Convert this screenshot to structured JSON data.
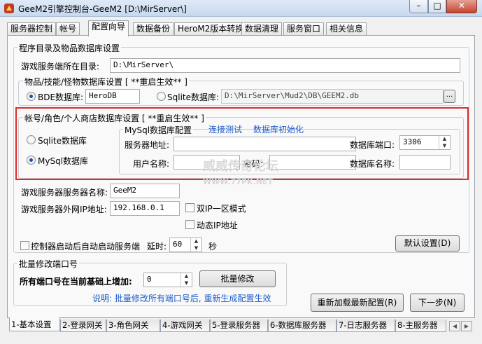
{
  "window": {
    "title": "GeeM2引擎控制台-GeeM2 [D:\\MirServer\\]"
  },
  "top_tabs": [
    "服务器控制",
    "帐号",
    "配置向导",
    "数据备份",
    "HeroM2版本转换",
    "数据清理",
    "服务窗口",
    "相关信息"
  ],
  "program_group": {
    "title": "程序目录及物品数据库设置",
    "server_dir_label": "游戏服务端所在目录:",
    "server_dir_value": "D:\\MirServer\\",
    "items_group": {
      "title": "物品/技能/怪物数据库设置 [ **重启生效** ]",
      "bde_label": "BDE数据库:",
      "bde_value": "HeroDB",
      "sqlite_label": "Sqlite数据库:",
      "sqlite_value": "D:\\MirServer\\Mud2\\DB\\GEEM2.db",
      "browse": "..."
    },
    "account_group": {
      "title": "帐号/角色/个人商店数据库设置 [ **重启生效** ]",
      "sqlite_label": "Sqlite数据库",
      "mysql_label": "MySql数据库",
      "mysql_config": {
        "title": "MySql数据库配置",
        "test_link": "连接测试",
        "init_link": "数据库初始化",
        "server_addr_label": "服务器地址:",
        "server_addr_value": "",
        "port_label": "数据库端口:",
        "port_value": "3306",
        "user_label": "用户名称:",
        "user_value": "",
        "password_label": "密码:",
        "password_value": "",
        "dbname_label": "数据库名称:",
        "dbname_value": ""
      }
    },
    "server_name_label": "游戏服务器服务器名称:",
    "server_name_value": "GeeM2",
    "ip_label": "游戏服务器外网IP地址:",
    "ip_value": "192.168.0.1",
    "dual_ip_label": "双IP一区模式",
    "dynamic_ip_label": "动态IP地址",
    "autostart_label": "控制器启动后自动启动服务端",
    "delay_label": "延时:",
    "delay_value": "60",
    "seconds_label": "秒",
    "default_btn": "默认设置(D)"
  },
  "batch_group": {
    "title": "批量修改端口号",
    "increase_label": "所有端口号在当前基础上增加:",
    "increase_value": "0",
    "modify_btn": "批量修改",
    "note": "说明: 批量修改所有端口号后, 重新生成配置生效"
  },
  "reload_btn": "重新加载最新配置(R)",
  "next_btn": "下一步(N)",
  "watermark": {
    "title": "威威传奇论坛",
    "url": "WWW.77PK.NET"
  },
  "bottom_tabs": [
    "1-基本设置",
    "2-登录网关",
    "3-角色网关",
    "4-游戏网关",
    "5-登录服务器",
    "6-数据库服务器",
    "7-日志服务器",
    "8-主服务器"
  ],
  "colors": {
    "highlight": "#e02a2a",
    "link": "#1f5dc7",
    "radio_dot": "#1a4fa8"
  }
}
